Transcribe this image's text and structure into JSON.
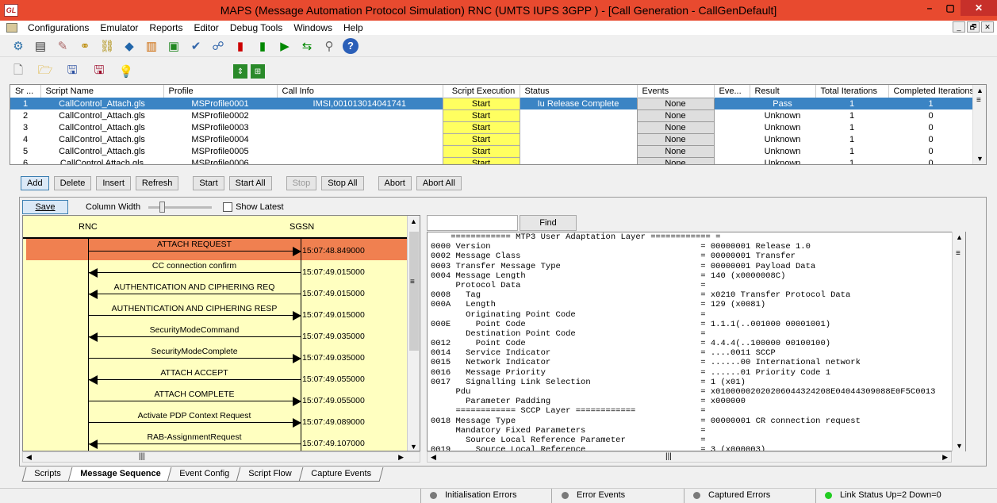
{
  "title": "MAPS (Message Automation Protocol Simulation) RNC (UMTS IUPS 3GPP ) - [Call Generation  - CallGenDefault]",
  "app_icon_text": "GL",
  "window_buttons": [
    "–",
    "▢",
    "✕"
  ],
  "menu": [
    "Configurations",
    "Emulator",
    "Reports",
    "Editor",
    "Debug Tools",
    "Windows",
    "Help"
  ],
  "mdi_buttons": [
    "_",
    "🗗",
    "✕"
  ],
  "toolbar1_icons": [
    "gear-icon",
    "list-icon",
    "script-edit-icon",
    "pair-icon",
    "chain-icon",
    "cube-icon",
    "books-icon",
    "lock-icon",
    "checklist-icon",
    "network-icon",
    "stop-script-icon",
    "call-script-icon",
    "play-script-icon",
    "cycle-icon",
    "debug-icon",
    "help-icon"
  ],
  "toolbar2_icons": [
    "new-file-icon",
    "open-folder-icon",
    "save-icon",
    "save-as-icon",
    "bulb-icon",
    "layout1-icon",
    "layout2-icon"
  ],
  "grid": {
    "headers": [
      "Sr ...",
      "Script Name",
      "Profile",
      "Call Info",
      "Script Execution",
      "Status",
      "Events",
      "Eve...",
      "Result",
      "Total Iterations",
      "Completed Iterations"
    ],
    "rows": [
      [
        "1",
        "CallControl_Attach.gls",
        "MSProfile0001",
        "IMSI,001013014041741",
        "Start",
        "Iu Release Complete",
        "None",
        "",
        "Pass",
        "1",
        "1"
      ],
      [
        "2",
        "CallControl_Attach.gls",
        "MSProfile0002",
        "",
        "Start",
        "",
        "None",
        "",
        "Unknown",
        "1",
        "0"
      ],
      [
        "3",
        "CallControl_Attach.gls",
        "MSProfile0003",
        "",
        "Start",
        "",
        "None",
        "",
        "Unknown",
        "1",
        "0"
      ],
      [
        "4",
        "CallControl_Attach.gls",
        "MSProfile0004",
        "",
        "Start",
        "",
        "None",
        "",
        "Unknown",
        "1",
        "0"
      ],
      [
        "5",
        "CallControl_Attach.gls",
        "MSProfile0005",
        "",
        "Start",
        "",
        "None",
        "",
        "Unknown",
        "1",
        "0"
      ],
      [
        "6",
        "CallControl Attach.gls",
        "MSProfile0006",
        "",
        "Start",
        "",
        "None",
        "",
        "Unknown",
        "1",
        "0"
      ]
    ]
  },
  "buttons": [
    "Add",
    "Delete",
    "Insert",
    "Refresh",
    "Start",
    "Start All",
    "Stop",
    "Stop All",
    "Abort",
    "Abort All"
  ],
  "save_label": "Save",
  "column_width_label": "Column Width",
  "show_latest_label": "Show Latest",
  "sequence": {
    "left_node": "RNC",
    "right_node": "SGSN",
    "messages": [
      {
        "label": "ATTACH REQUEST",
        "dir": "right",
        "ts": "15:07:48.849000"
      },
      {
        "label": "CC connection confirm",
        "dir": "left",
        "ts": "15:07:49.015000"
      },
      {
        "label": "AUTHENTICATION AND CIPHERING REQ",
        "dir": "left",
        "ts": "15:07:49.015000"
      },
      {
        "label": "AUTHENTICATION AND CIPHERING RESP",
        "dir": "right",
        "ts": "15:07:49.015000"
      },
      {
        "label": "SecurityModeCommand",
        "dir": "left",
        "ts": "15:07:49.035000"
      },
      {
        "label": "SecurityModeComplete",
        "dir": "right",
        "ts": "15:07:49.035000"
      },
      {
        "label": "ATTACH ACCEPT",
        "dir": "left",
        "ts": "15:07:49.055000"
      },
      {
        "label": "ATTACH COMPLETE",
        "dir": "right",
        "ts": "15:07:49.055000"
      },
      {
        "label": "Activate PDP Context Request",
        "dir": "right",
        "ts": "15:07:49.089000"
      },
      {
        "label": "RAB-AssignmentRequest",
        "dir": "left",
        "ts": "15:07:49.107000"
      }
    ]
  },
  "find_label": "Find",
  "find_value": "",
  "detail_lines": [
    "    ============ MTP3 User Adaptation Layer ============ =",
    "0000 Version                                          = 00000001 Release 1.0",
    "0002 Message Class                                    = 00000001 Transfer",
    "0003 Transfer Message Type                            = 00000001 Payload Data",
    "0004 Message Length                                   = 140 (x0000008C)",
    "     Protocol Data                                    =",
    "0008   Tag                                            = x0210 Transfer Protocol Data",
    "000A   Length                                         = 129 (x0081)",
    "       Originating Point Code                         =",
    "000E     Point Code                                   = 1.1.1(..001000 00001001)",
    "       Destination Point Code                         =",
    "0012     Point Code                                   = 4.4.4(..100000 00100100)",
    "0014   Service Indicator                              = ....0011 SCCP",
    "0015   Network Indicator                              = ......00 International network",
    "0016   Message Priority                               = ......01 Priority Code 1",
    "0017   Signalling Link Selection                      = 1 (x01)",
    "     Pdu                                              = x01000002020206044324208E04044309088E0F5C0013",
    "       Parameter Padding                              = x000000",
    "     ============ SCCP Layer ============             =",
    "0018 Message Type                                     = 00000001 CR connection request",
    "     Mandatory Fixed Parameters                       =",
    "       Source Local Reference Parameter               =",
    "0019     Source Local Reference                       = 3 (x000003)"
  ],
  "tabs": [
    "Scripts",
    "Message Sequence",
    "Event Config",
    "Script Flow",
    "Capture Events"
  ],
  "active_tab": "Message Sequence",
  "status": [
    {
      "label": "Initialisation Errors",
      "color": "#7a7a7a"
    },
    {
      "label": "Error Events",
      "color": "#7a7a7a"
    },
    {
      "label": "Captured Errors",
      "color": "#7a7a7a"
    },
    {
      "label": "Link Status Up=2 Down=0",
      "color": "#22cc22"
    }
  ],
  "colors": {
    "titlebar": "#e84a2f",
    "selected_row": "#3b84c4",
    "seq_bg": "#ffffc0",
    "seq_highlight": "#f08050",
    "start_cell": "#ffff60"
  }
}
